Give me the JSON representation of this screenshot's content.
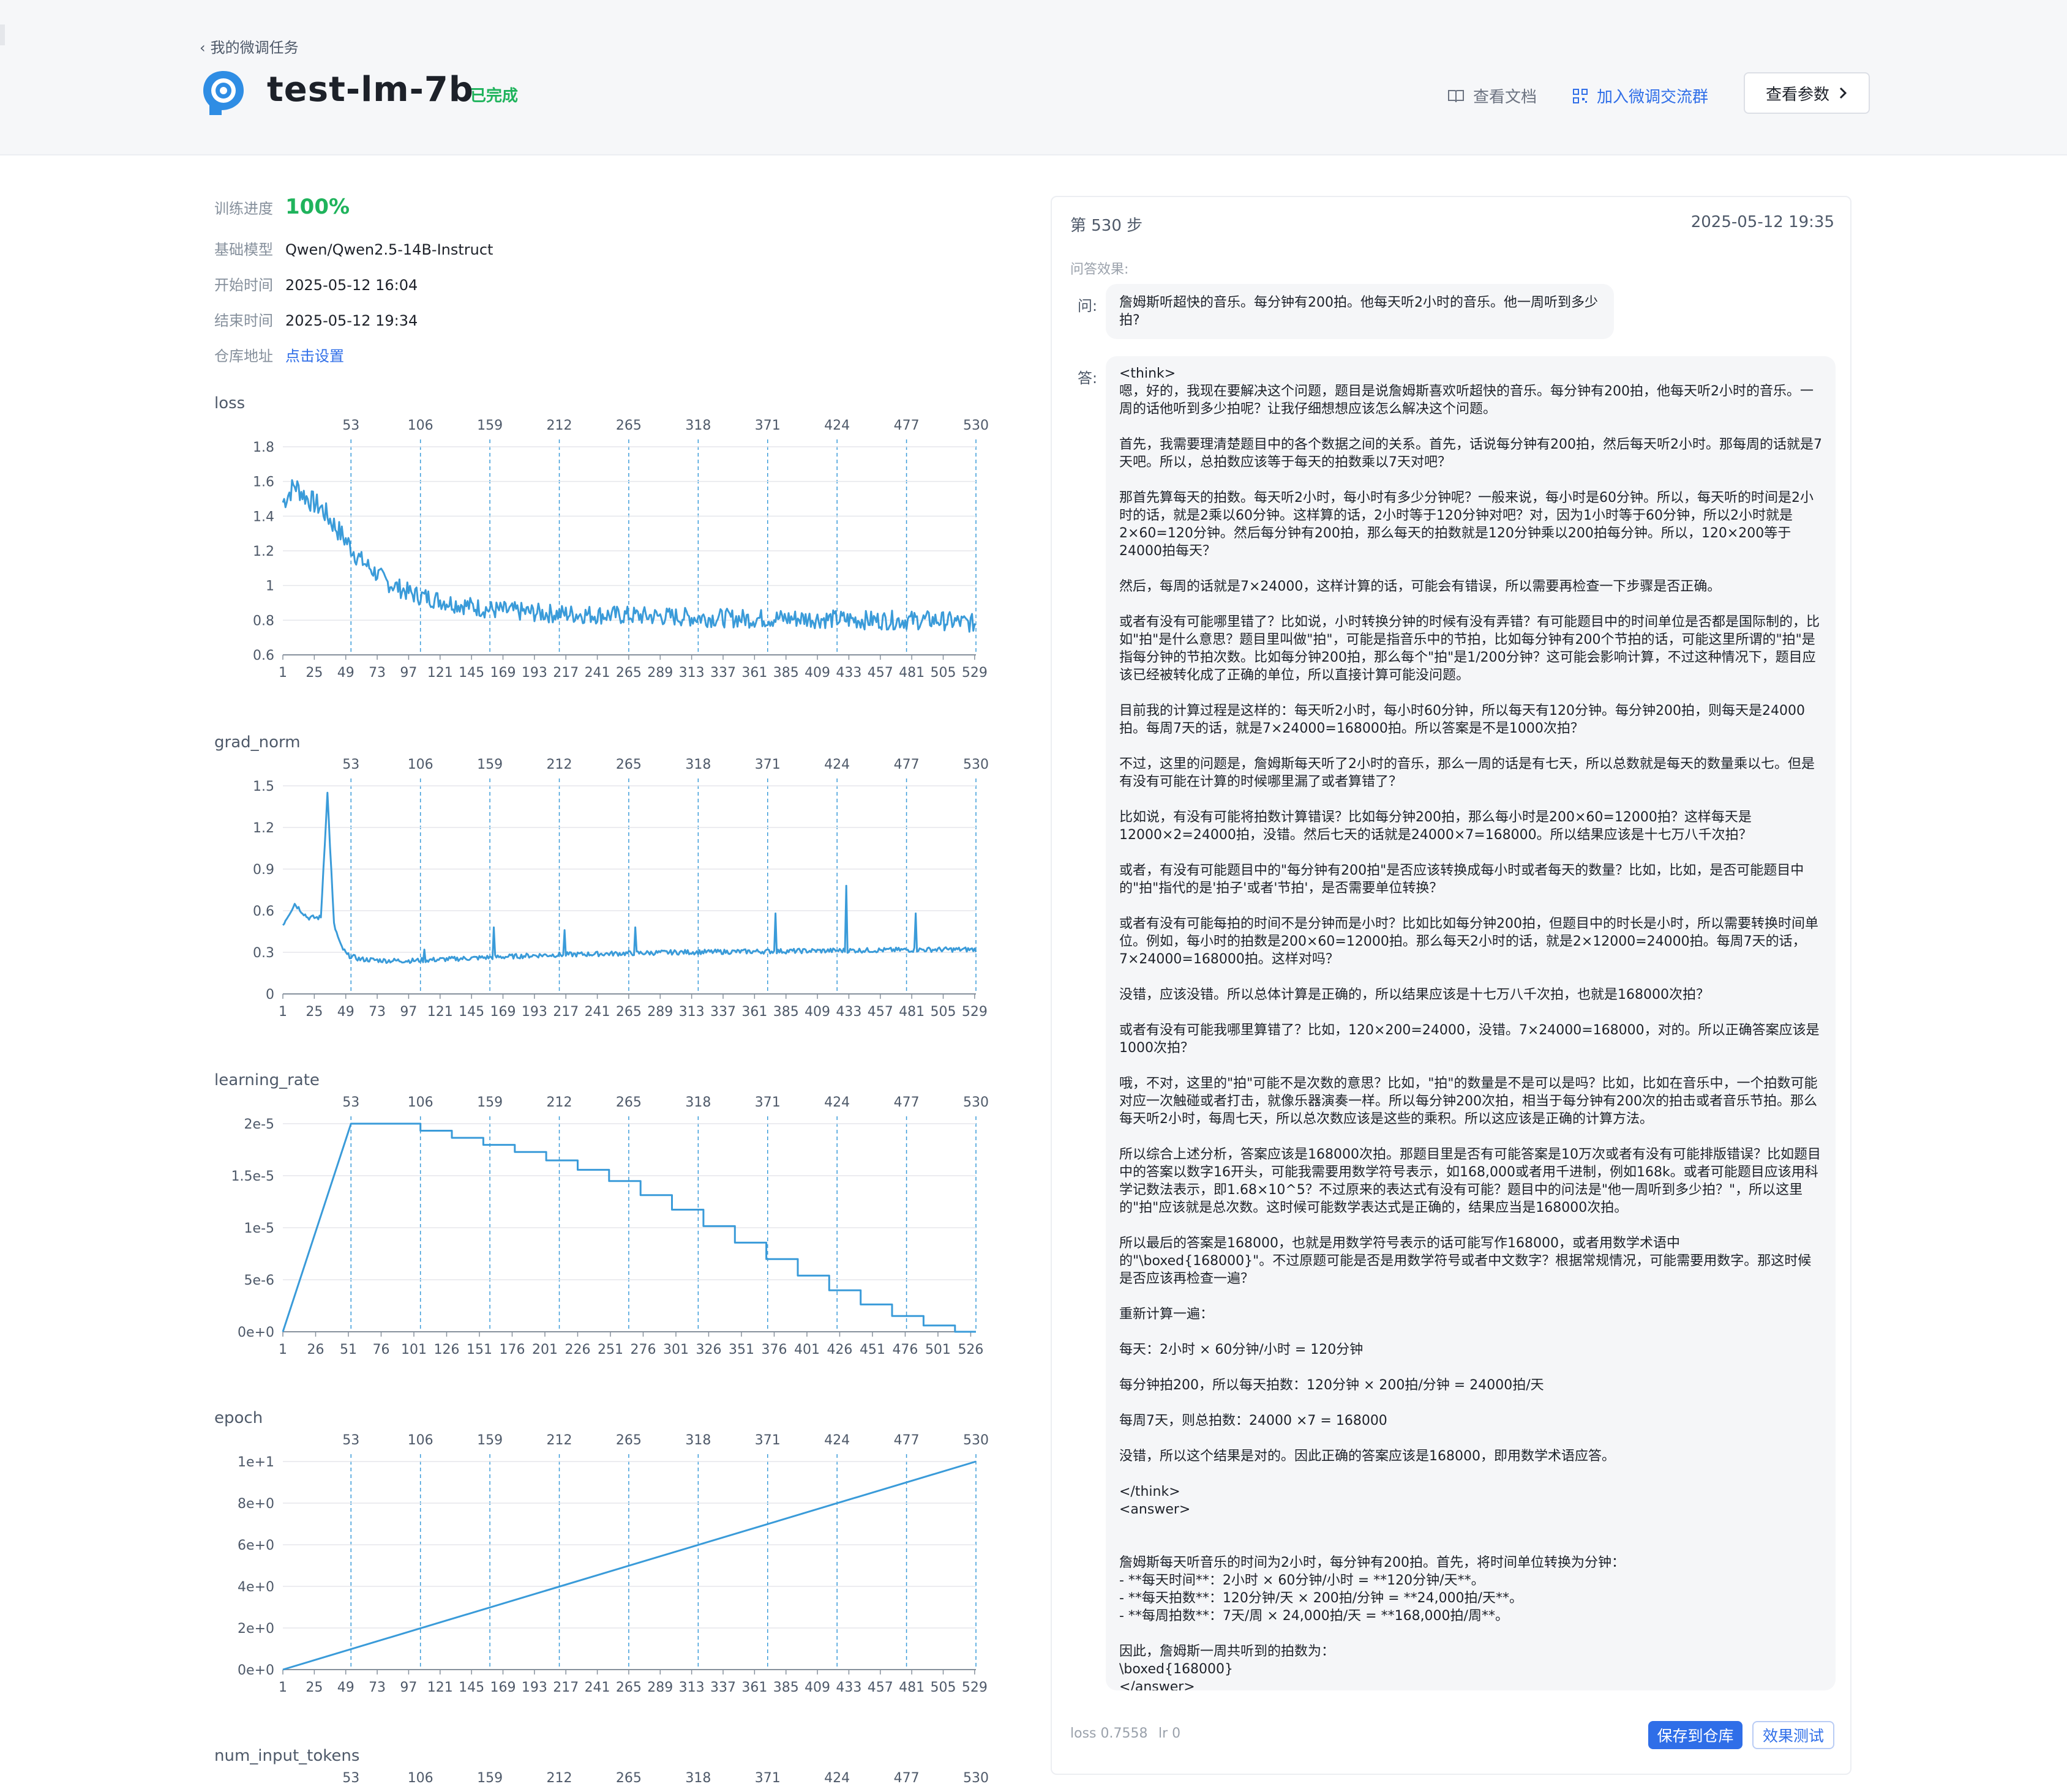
{
  "header": {
    "back_label": "我的微调任务",
    "title": "test-lm-7b",
    "status": "已完成",
    "docs_label": "查看文档",
    "group_label": "加入微调交流群",
    "params_label": "查看参数"
  },
  "info": {
    "progress_key": "训练进度",
    "progress_value": "100%",
    "model_key": "基础模型",
    "model_value": "Qwen/Qwen2.5-14B-Instruct",
    "start_key": "开始时间",
    "start_value": "2025-05-12 16:04",
    "end_key": "结束时间",
    "end_value": "2025-05-12 19:34",
    "repo_key": "仓库地址",
    "repo_value": "点击设置"
  },
  "chart_data": [
    {
      "type": "line",
      "title": "loss",
      "top_ticks": [
        "53",
        "106",
        "159",
        "212",
        "265",
        "318",
        "371",
        "424",
        "477",
        "530"
      ],
      "x_ticks": [
        "1",
        "25",
        "49",
        "73",
        "97",
        "121",
        "145",
        "169",
        "193",
        "217",
        "241",
        "265",
        "289",
        "313",
        "337",
        "361",
        "385",
        "409",
        "433",
        "457",
        "481",
        "505",
        "529"
      ],
      "y_ticks": [
        "0.6",
        "0.8",
        "1",
        "1.2",
        "1.4",
        "1.6",
        "1.8"
      ],
      "ylim": [
        0.6,
        1.8
      ],
      "xlim": [
        1,
        530
      ],
      "color": "#3a9bd9",
      "series": [
        {
          "x": [
            1,
            10,
            20,
            30,
            40,
            60,
            80,
            100,
            130,
            160,
            200,
            250,
            300,
            350,
            400,
            450,
            500,
            530
          ],
          "values": [
            1.48,
            1.58,
            1.5,
            1.45,
            1.35,
            1.15,
            1.02,
            0.95,
            0.9,
            0.86,
            0.84,
            0.83,
            0.82,
            0.81,
            0.81,
            0.8,
            0.8,
            0.78
          ]
        }
      ]
    },
    {
      "type": "line",
      "title": "grad_norm",
      "top_ticks": [
        "53",
        "106",
        "159",
        "212",
        "265",
        "318",
        "371",
        "424",
        "477",
        "530"
      ],
      "x_ticks": [
        "1",
        "25",
        "49",
        "73",
        "97",
        "121",
        "145",
        "169",
        "193",
        "217",
        "241",
        "265",
        "289",
        "313",
        "337",
        "361",
        "385",
        "409",
        "433",
        "457",
        "481",
        "505",
        "529"
      ],
      "y_ticks": [
        "0",
        "0.3",
        "0.6",
        "0.9",
        "1.2",
        "1.5"
      ],
      "ylim": [
        0,
        1.5
      ],
      "xlim": [
        1,
        530
      ],
      "color": "#3a9bd9",
      "series": [
        {
          "x": [
            1,
            10,
            20,
            30,
            35,
            40,
            45,
            50,
            60,
            80,
            100,
            150,
            200,
            300,
            400,
            500,
            530
          ],
          "values": [
            0.5,
            0.65,
            0.55,
            0.55,
            1.45,
            0.5,
            0.35,
            0.28,
            0.25,
            0.24,
            0.24,
            0.26,
            0.28,
            0.3,
            0.31,
            0.32,
            0.32
          ]
        }
      ],
      "spikes": [
        {
          "x": 35,
          "y": 1.45
        },
        {
          "x": 109,
          "y": 0.32
        },
        {
          "x": 162,
          "y": 0.48
        },
        {
          "x": 216,
          "y": 0.46
        },
        {
          "x": 270,
          "y": 0.48
        },
        {
          "x": 377,
          "y": 0.58
        },
        {
          "x": 431,
          "y": 0.78
        },
        {
          "x": 484,
          "y": 0.58
        }
      ]
    },
    {
      "type": "line",
      "title": "learning_rate",
      "top_ticks": [
        "53",
        "106",
        "159",
        "212",
        "265",
        "318",
        "371",
        "424",
        "477",
        "530"
      ],
      "x_ticks": [
        "1",
        "26",
        "51",
        "76",
        "101",
        "126",
        "151",
        "176",
        "201",
        "226",
        "251",
        "276",
        "301",
        "326",
        "351",
        "376",
        "401",
        "426",
        "451",
        "476",
        "501",
        "526"
      ],
      "y_ticks": [
        "0e+0",
        "5e-6",
        "1e-5",
        "1.5e-5",
        "2e-5"
      ],
      "ylim": [
        0,
        2e-05
      ],
      "xlim": [
        1,
        530
      ],
      "color": "#3a9bd9",
      "series": [
        {
          "x": [
            1,
            53,
            106,
            159,
            212,
            265,
            318,
            371,
            424,
            477,
            530
          ],
          "values": [
            0,
            2e-05,
            2e-05,
            1.85e-05,
            1.7e-05,
            1.5e-05,
            1.2e-05,
            8.5e-06,
            5e-06,
            2e-06,
            0
          ]
        }
      ]
    },
    {
      "type": "line",
      "title": "epoch",
      "top_ticks": [
        "53",
        "106",
        "159",
        "212",
        "265",
        "318",
        "371",
        "424",
        "477",
        "530"
      ],
      "x_ticks": [
        "1",
        "25",
        "49",
        "73",
        "97",
        "121",
        "145",
        "169",
        "193",
        "217",
        "241",
        "265",
        "289",
        "313",
        "337",
        "361",
        "385",
        "409",
        "433",
        "457",
        "481",
        "505",
        "529"
      ],
      "y_ticks": [
        "0e+0",
        "2e+0",
        "4e+0",
        "6e+0",
        "8e+0",
        "1e+1"
      ],
      "ylim": [
        0,
        10
      ],
      "xlim": [
        1,
        530
      ],
      "color": "#3a9bd9",
      "series": [
        {
          "x": [
            1,
            530
          ],
          "values": [
            0,
            10
          ]
        }
      ]
    },
    {
      "type": "line",
      "title": "num_input_tokens",
      "top_ticks": [
        "53",
        "106",
        "159",
        "212",
        "265",
        "318",
        "371",
        "424",
        "477",
        "530"
      ]
    }
  ],
  "panel": {
    "step": "第 530 步",
    "time": "2025-05-12 19:35",
    "qa_label": "问答效果:",
    "q_label": "问:",
    "a_label": "答:",
    "question": "詹姆斯听超快的音乐。每分钟有200拍。他每天听2小时的音乐。他一周听到多少拍?",
    "answer": "<think>\n嗯，好的，我现在要解决这个问题，题目是说詹姆斯喜欢听超快的音乐。每分钟有200拍，他每天听2小时的音乐。一周的话他听到多少拍呢？让我仔细想想应该怎么解决这个问题。\n\n首先，我需要理清楚题目中的各个数据之间的关系。首先，话说每分钟有200拍，然后每天听2小时。那每周的话就是7天吧。所以，总拍数应该等于每天的拍数乘以7天对吧？\n\n那首先算每天的拍数。每天听2小时，每小时有多少分钟呢？一般来说，每小时是60分钟。所以，每天听的时间是2小时的话，就是2乘以60分钟。这样算的话，2小时等于120分钟对吧？对，因为1小时等于60分钟，所以2小时就是2×60=120分钟。然后每分钟有200拍，那么每天的拍数就是120分钟乘以200拍每分钟。所以，120×200等于24000拍每天？\n\n然后，每周的话就是7×24000，这样计算的话，可能会有错误，所以需要再检查一下步骤是否正确。\n\n或者有没有可能哪里错了？比如说，小时转换分钟的时候有没有弄错？有可能题目中的时间单位是否都是国际制的，比如\"拍\"是什么意思？题目里叫做\"拍\"，可能是指音乐中的节拍，比如每分钟有200个节拍的话，可能这里所谓的\"拍\"是指每分钟的节拍次数。比如每分钟200拍，那么每个\"拍\"是1/200分钟？这可能会影响计算，不过这种情况下，题目应该已经被转化成了正确的单位，所以直接计算可能没问题。\n\n目前我的计算过程是这样的：每天听2小时，每小时60分钟，所以每天有120分钟。每分钟200拍，则每天是24000拍。每周7天的话，就是7×24000=168000拍。所以答案是不是1000次拍？\n\n不过，这里的问题是，詹姆斯每天听了2小时的音乐，那么一周的话是有七天，所以总数就是每天的数量乘以七。但是有没有可能在计算的时候哪里漏了或者算错了？\n\n比如说，有没有可能将拍数计算错误？比如每分钟200拍，那么每小时是200×60=12000拍？这样每天是12000×2=24000拍，没错。然后七天的话就是24000×7=168000。所以结果应该是十七万八千次拍？\n\n或者，有没有可能题目中的\"每分钟有200拍\"是否应该转换成每小时或者每天的数量？比如，比如，是否可能题目中的\"拍\"指代的是'拍子'或者'节拍'，是否需要单位转换？\n\n或者有没有可能每拍的时间不是分钟而是小时？比如比如每分钟200拍，但题目中的时长是小时，所以需要转换时间单位。例如，每小时的拍数是200×60=12000拍。那么每天2小时的话，就是2×12000=24000拍。每周7天的话，7×24000=168000拍。这样对吗？\n\n没错，应该没错。所以总体计算是正确的，所以结果应该是十七万八千次拍，也就是168000次拍？\n\n或者有没有可能我哪里算错了？比如，120×200=24000，没错。7×24000=168000，对的。所以正确答案应该是1000次拍？\n\n哦，不对，这里的\"拍\"可能不是次数的意思？比如，\"拍\"的数量是不是可以是吗？比如，比如在音乐中，一个拍数可能对应一次触碰或者打击，就像乐器演奏一样。所以每分钟200次拍，相当于每分钟有200次的拍击或者音乐节拍。那么每天听2小时，每周七天，所以总次数应该是这些的乘积。所以这应该是正确的计算方法。\n\n所以综合上述分析，答案应该是168000次拍。那题目里是否有可能答案是10万次或者有没有可能排版错误？比如题目中的答案以数字16开头，可能我需要用数学符号表示，如168,000或者用千进制，例如168k。或者可能题目应该用科学记数法表示，即1.68×10^5？不过原来的表达式有没有可能？题目中的问法是\"他一周听到多少拍？\"，所以这里的\"拍\"应该就是总次数。这时候可能数学表达式是正确的，结果应当是168000次拍。\n\n所以最后的答案是168000，也就是用数学符号表示的话可能写作168000，或者用数学术语中的\"\\boxed{168000}\"。不过原题可能是否是用数学符号或者中文数字？根据常规情况，可能需要用数字。那这时候是否应该再检查一遍？\n\n重新计算一遍：\n\n每天：2小时 × 60分钟/小时 = 120分钟\n\n每分钟拍200，所以每天拍数：120分钟 × 200拍/分钟 = 24000拍/天\n\n每周7天，则总拍数：24000 ×7 = 168000\n\n没错，所以这个结果是对的。因此正确的答案应该是168000，即用数学术语应答。\n\n</think>\n<answer>\n\n\n詹姆斯每天听音乐的时间为2小时，每分钟有200拍。首先，将时间单位转换为分钟：\n- **每天时间**：2小时 × 60分钟/小时 = **120分钟/天**。\n- **每天拍数**：120分钟/天 × 200拍/分钟 = **24,000拍/天**。\n- **每周拍数**：7天/周 × 24,000拍/天 = **168,000拍/周**。\n\n因此，詹姆斯一周共听到的拍数为：\n\\boxed{168000}\n</answer>",
    "loss_text": "loss 0.7558",
    "lr_text": "lr 0",
    "save_label": "保存到仓库",
    "test_label": "效果测试"
  }
}
